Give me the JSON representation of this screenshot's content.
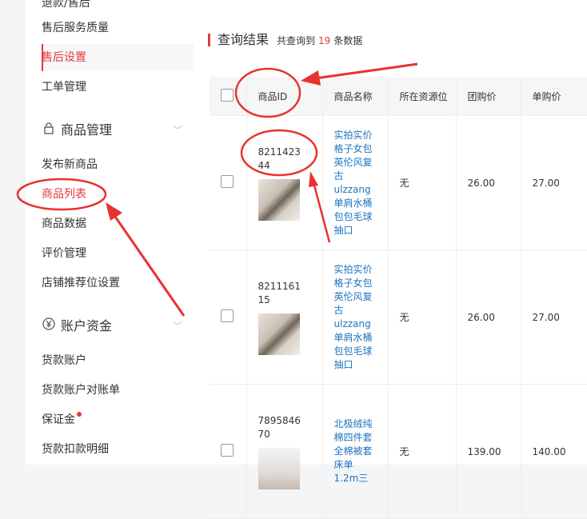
{
  "sidebar": {
    "items_top": [
      {
        "label": "售后服务质量",
        "active": false
      },
      {
        "label": "售后设置",
        "active": true
      },
      {
        "label": "工单管理",
        "active": false
      }
    ],
    "group_goods": {
      "label": "商品管理",
      "icon": "lock-icon"
    },
    "goods_items": [
      {
        "label": "发布新商品"
      },
      {
        "label": "商品列表"
      },
      {
        "label": "商品数据"
      },
      {
        "label": "评价管理"
      },
      {
        "label": "店铺推荐位设置"
      }
    ],
    "group_funds": {
      "label": "账户资金",
      "icon": "yen-icon"
    },
    "funds_items": [
      {
        "label": "货款账户"
      },
      {
        "label": "货款账户对账单"
      },
      {
        "label": "保证金",
        "badge_dot": true
      },
      {
        "label": "货款扣款明细"
      }
    ]
  },
  "results": {
    "title": "查询结果",
    "sub_prefix": "共查询到",
    "count": "19",
    "sub_suffix": "条数据"
  },
  "table": {
    "columns": [
      "商品ID",
      "商品名称",
      "所在资源位",
      "团购价",
      "单购价"
    ],
    "rows": [
      {
        "id": "821142344",
        "name": "实拍实价格子女包英伦风复古ulzzang单肩水桶包包毛球抽口",
        "resource": "无",
        "group_price": "26.00",
        "single_price": "27.00"
      },
      {
        "id": "821116115",
        "name": "实拍实价格子女包英伦风复古ulzzang单肩水桶包包毛球抽口",
        "resource": "无",
        "group_price": "26.00",
        "single_price": "27.00"
      },
      {
        "id": "789584670",
        "name": "北极绒纯棉四件套全棉被套床单1.2m三",
        "resource": "无",
        "group_price": "139.00",
        "single_price": "140.00"
      }
    ]
  },
  "colors": {
    "accent": "#e4393c",
    "link": "#1e73be",
    "annotation": "#e8322e"
  }
}
